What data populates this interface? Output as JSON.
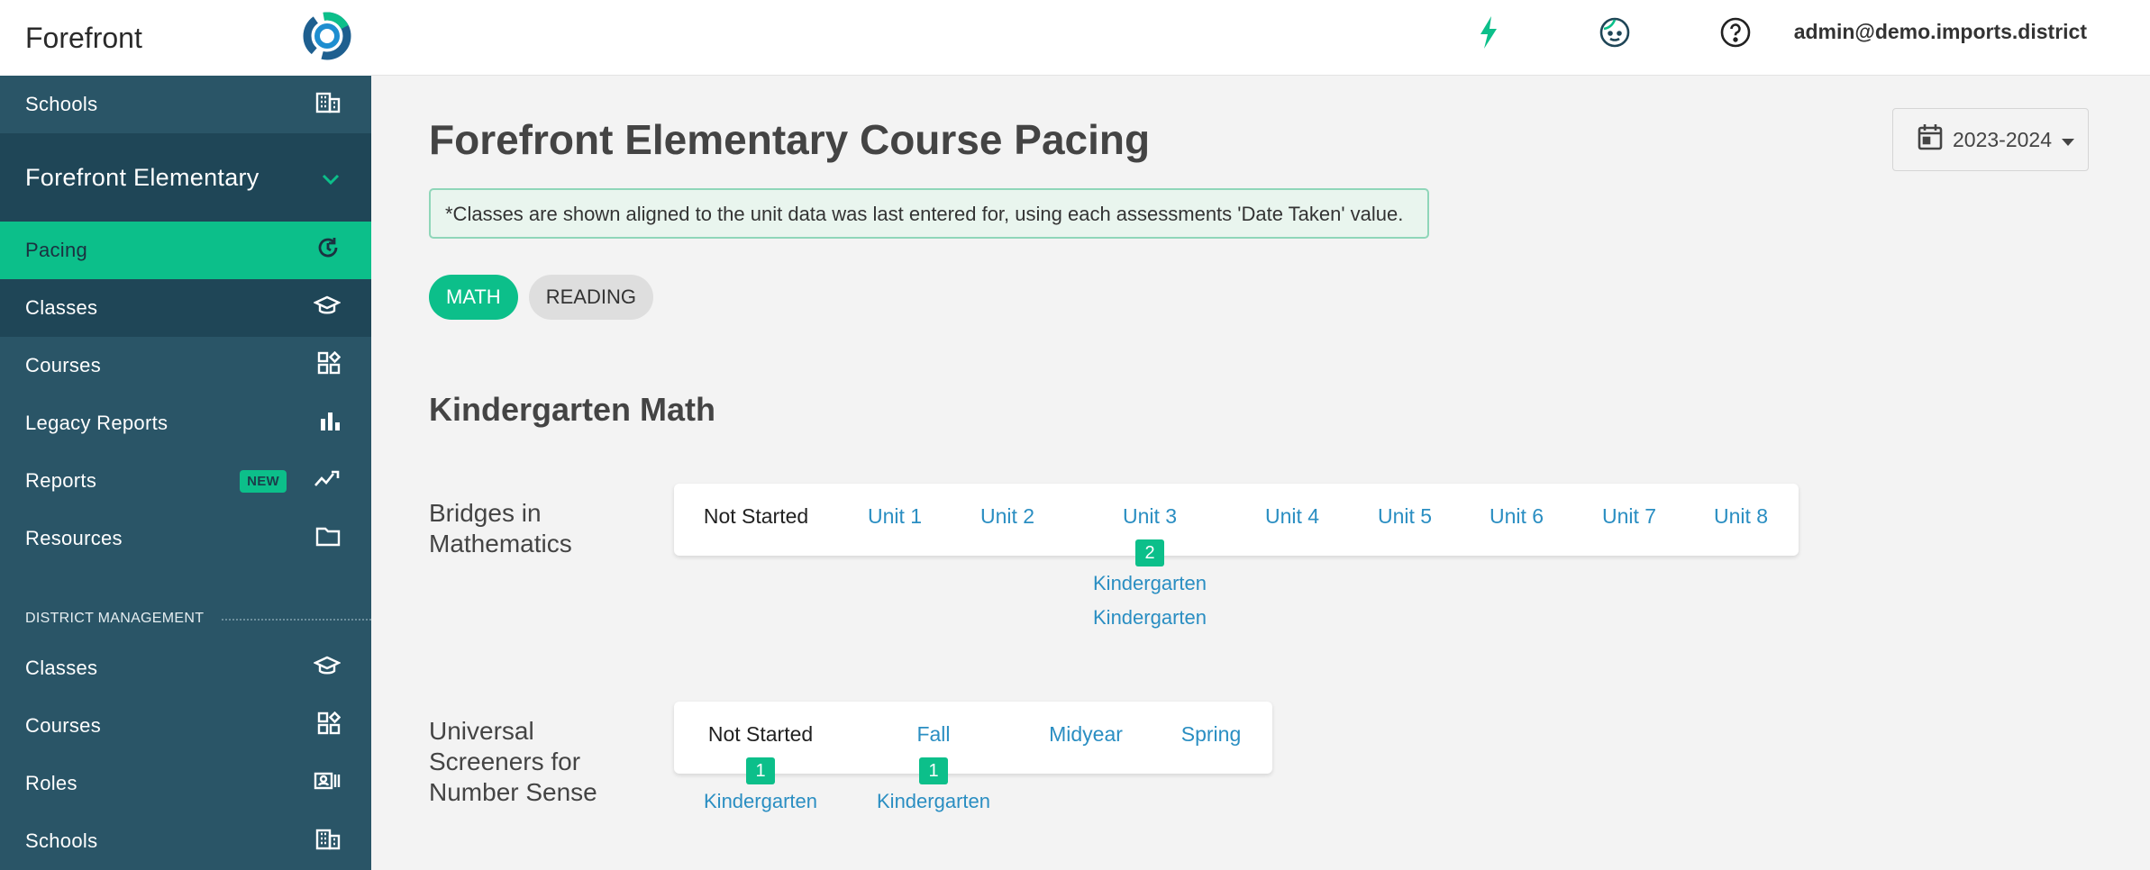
{
  "app": {
    "name": "Forefront"
  },
  "sidebar": {
    "top_items": [
      {
        "label": "Schools",
        "icon": "building-icon"
      }
    ],
    "org": {
      "label": "Forefront Elementary",
      "icon": "chevron-down-icon"
    },
    "school_items": [
      {
        "label": "Pacing",
        "icon": "refresh-icon",
        "state": "active"
      },
      {
        "label": "Classes",
        "icon": "graduation-cap-icon",
        "state": "selected"
      },
      {
        "label": "Courses",
        "icon": "grid-icon"
      },
      {
        "label": "Legacy Reports",
        "icon": "bar-chart-icon"
      },
      {
        "label": "Reports",
        "icon": "trending-icon",
        "badge": "NEW"
      },
      {
        "label": "Resources",
        "icon": "folder-icon"
      }
    ],
    "district_section": "DISTRICT MANAGEMENT",
    "district_items": [
      {
        "label": "Classes",
        "icon": "graduation-cap-icon"
      },
      {
        "label": "Courses",
        "icon": "grid-icon"
      },
      {
        "label": "Roles",
        "icon": "id-card-icon"
      },
      {
        "label": "Schools",
        "icon": "building-icon"
      }
    ]
  },
  "header": {
    "icons": [
      "bolt-icon",
      "face-icon",
      "help-icon"
    ],
    "user_email": "admin@demo.imports.district"
  },
  "main": {
    "title": "Forefront Elementary Course Pacing",
    "year": "2023-2024",
    "notice": "*Classes are shown aligned to the unit data was last entered for, using each assessments 'Date Taken' value.",
    "tabs": [
      {
        "label": "MATH",
        "active": true
      },
      {
        "label": "READING",
        "active": false
      }
    ],
    "subject_title": "Kindergarten Math",
    "courses": [
      {
        "name_lines": [
          "Bridges in",
          "Mathematics"
        ],
        "stages": [
          {
            "label": "Not Started"
          },
          {
            "label": "Unit 1"
          },
          {
            "label": "Unit 2"
          },
          {
            "label": "Unit 3",
            "count": "2",
            "classes": [
              "Kindergarten",
              "Kindergarten"
            ]
          },
          {
            "label": "Unit 4"
          },
          {
            "label": "Unit 5"
          },
          {
            "label": "Unit 6"
          },
          {
            "label": "Unit 7"
          },
          {
            "label": "Unit 8"
          }
        ]
      },
      {
        "name_lines": [
          "Universal",
          "Screeners for",
          "Number Sense"
        ],
        "stages": [
          {
            "label": "Not Started",
            "count": "1",
            "classes": [
              "Kindergarten"
            ]
          },
          {
            "label": "Fall",
            "count": "1",
            "classes": [
              "Kindergarten"
            ]
          },
          {
            "label": "Midyear"
          },
          {
            "label": "Spring"
          }
        ]
      }
    ]
  },
  "colors": {
    "sidebar_bg": "#2a5567",
    "sidebar_dark": "#1f4657",
    "accent": "#0cbf8a",
    "link": "#2a8ec2"
  }
}
